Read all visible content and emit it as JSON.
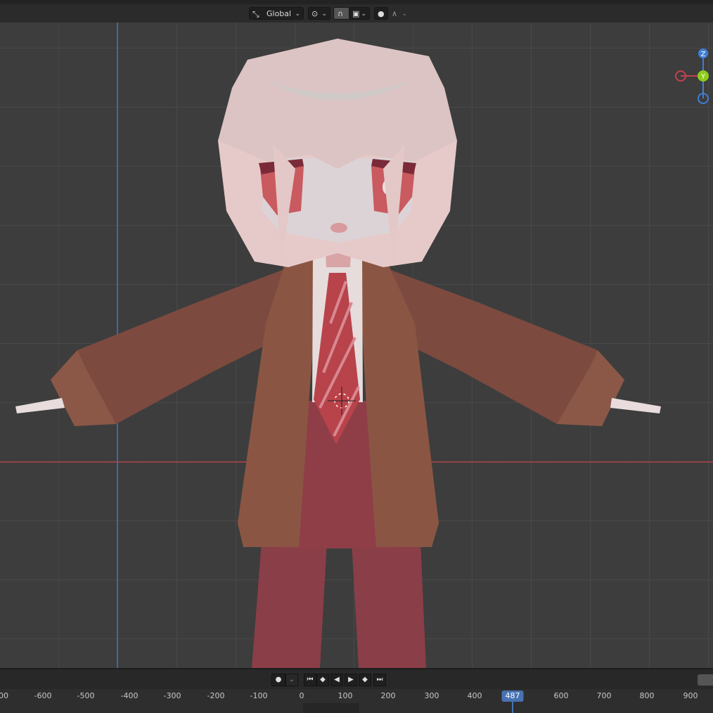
{
  "header": {
    "orientation_label": "Global",
    "orientation_icon": "transform-orientation-icon",
    "pivot_icon": "pivot-point-icon",
    "snap_icon": "snap-magnet-icon",
    "snap_target_icon": "snap-target-icon",
    "proportional_icon": "proportional-editing-icon",
    "falloff_icon": "falloff-curve-icon"
  },
  "viewport": {
    "gizmo": {
      "z_label": "Z",
      "y_label": "Y"
    }
  },
  "playback": {
    "keyframe_icon": "record-dot-icon",
    "jump_start_icon": "jump-start-icon",
    "prev_keyframe_icon": "prev-keyframe-icon",
    "play_reverse_icon": "play-reverse-icon",
    "play_icon": "play-icon",
    "next_keyframe_icon": "next-keyframe-icon",
    "jump_end_icon": "jump-end-icon"
  },
  "timeline": {
    "ticks": [
      "00",
      "-600",
      "-500",
      "-400",
      "-300",
      "-200",
      "-100",
      "0",
      "100",
      "200",
      "300",
      "400",
      "600",
      "700",
      "800",
      "900"
    ],
    "current_frame": "487",
    "accent_color": "#4772b3"
  },
  "colors": {
    "axis_x": "#c4414b",
    "axis_y": "#8ccc1c",
    "axis_z": "#3f7ed6"
  }
}
